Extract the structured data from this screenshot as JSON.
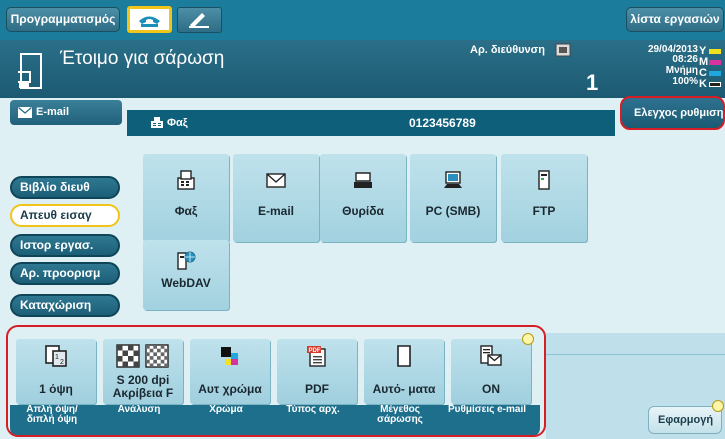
{
  "topbar": {
    "programming_label": "Προγραμματισμός",
    "job_list_label": "λίστα εργασιών",
    "mode_icons": [
      "fax-mode-icon",
      "scan-mode-icon"
    ]
  },
  "status": {
    "title": "Έτοιμο για σάρωση",
    "address_label": "Αρ. διεύθυνση",
    "address_count": "1",
    "date": "29/04/2013",
    "time": "08:26",
    "memory_label": "Μνήμη",
    "memory_value": "100%",
    "toner": [
      {
        "letter": "Y",
        "color": "#f2e21d"
      },
      {
        "letter": "M",
        "color": "#d6339e"
      },
      {
        "letter": "C",
        "color": "#1fa7df"
      },
      {
        "letter": "K",
        "color": "#222222"
      }
    ]
  },
  "address_bar": {
    "tab_label": "E-mail",
    "destination_type": "Φαξ",
    "destination_number": "0123456789",
    "check_settings_label": "Ελεγχος ρυθμισης"
  },
  "nav": [
    {
      "label": "Βιβλίο διευθ",
      "active": false
    },
    {
      "label": "Απευθ εισαγ",
      "active": true
    },
    {
      "label": "Ιστορ εργασ.",
      "active": false
    },
    {
      "label": "Αρ. προορισμ",
      "active": false
    },
    {
      "label": "Καταχώριση",
      "active": false
    }
  ],
  "destinations": [
    {
      "label": "Φαξ",
      "icon": "fax-icon"
    },
    {
      "label": "E-mail",
      "icon": "envelope-icon"
    },
    {
      "label": "Θυρίδα",
      "icon": "box-icon"
    },
    {
      "label": "PC (SMB)",
      "icon": "computer-icon"
    },
    {
      "label": "FTP",
      "icon": "server-icon"
    },
    {
      "label": "WebDAV",
      "icon": "webdav-icon"
    }
  ],
  "settings": [
    {
      "value": "1 όψη",
      "caption": "Απλή όψη/ διπλή όψη",
      "icon": "simplex-icon"
    },
    {
      "value": "S 200 dpi Ακρίβεια F",
      "caption": "Ανάλυση",
      "icon": "resolution-icon"
    },
    {
      "value": "Αυτ χρώμα",
      "caption": "Χρώμα",
      "icon": "color-icon"
    },
    {
      "value": "PDF",
      "caption": "Τύπος αρχ.",
      "icon": "pdf-icon"
    },
    {
      "value": "Αυτό- ματα",
      "caption": "Μέγεθος σάρωσης",
      "icon": "paper-size-icon"
    },
    {
      "value": "ON",
      "caption": "Ρυθμίσεις e-mail",
      "icon": "email-settings-icon"
    }
  ],
  "apply_label": "Εφαρμογή"
}
